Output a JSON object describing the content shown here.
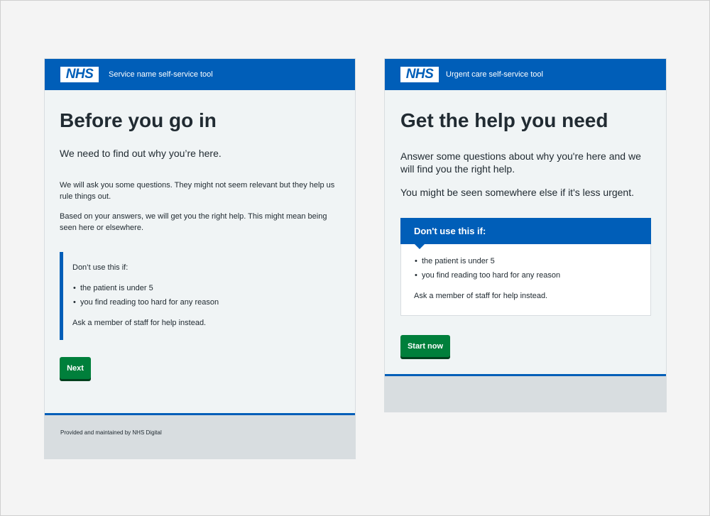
{
  "left": {
    "logo": "NHS",
    "service_name": "Service name self-service tool",
    "title": "Before you go in",
    "lead": "We need to find out why you’re here.",
    "para1": "We will ask you some questions. They might not seem relevant but they help us rule things out.",
    "para2": "Based on your answers, we will get you the right help. This might mean being seen here or elsewhere.",
    "inset": {
      "intro": "Don’t use this if:",
      "items": [
        "the patient is under 5",
        "you find reading too hard for any reason"
      ],
      "outro": "Ask a member of staff for help instead."
    },
    "button": "Next",
    "footer": "Provided and maintained by NHS Digital"
  },
  "right": {
    "logo": "NHS",
    "service_name": "Urgent care self-service tool",
    "title": "Get the help you need",
    "para1": "Answer some questions about why you're here and we will find you the right help.",
    "para2": "You might be seen somewhere else if it's less urgent.",
    "card": {
      "heading": "Don't use this if:",
      "items": [
        "the patient is under 5",
        "you find reading too hard for any reason"
      ],
      "outro": "Ask a member of staff for help instead."
    },
    "button": "Start now"
  },
  "colors": {
    "nhs_blue": "#005eb8",
    "button_green": "#007f3b",
    "panel_bg": "#f0f4f5",
    "footer_bg": "#d8dde0",
    "text": "#212b32"
  },
  "icons": [
    "nhs-logo"
  ]
}
